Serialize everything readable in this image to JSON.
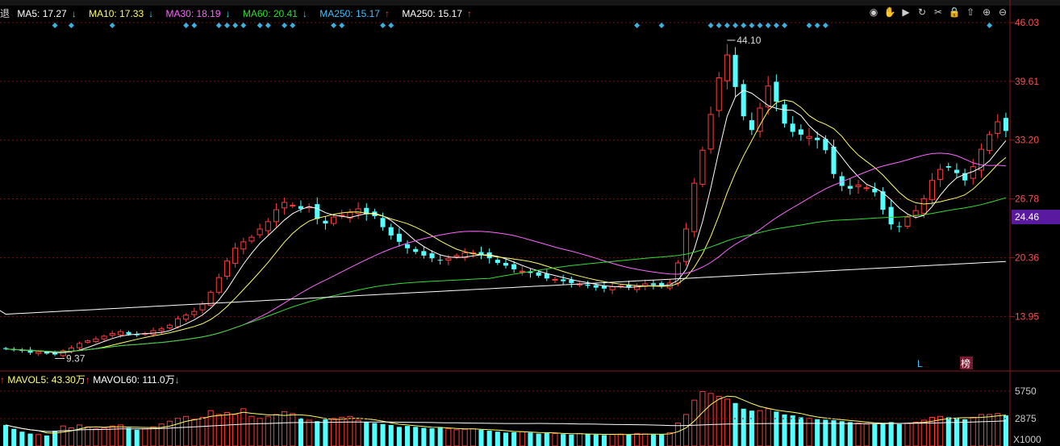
{
  "legend": {
    "ma5": "MA5: 17.27",
    "ma5_dir": "↓",
    "ma10": "MA10: 17.33",
    "ma10_dir": "↓",
    "ma30": "MA30: 18.19",
    "ma30_dir": "↓",
    "ma60": "MA60: 20.41",
    "ma60_dir": "↓",
    "ma250a": "MA250: 15.17",
    "ma250a_dir": "↑",
    "ma250b": "MA250: 15.17",
    "ma250b_dir": "↑"
  },
  "vol_legend": {
    "mavol5": "MAVOL5: 43.30万",
    "mavol5_dir": "↑",
    "mavol60": "MAVOL60: 111.0万",
    "mavol60_dir": "↓"
  },
  "colors": {
    "up": "#ff3b3b",
    "down": "#54ffff",
    "ma5": "#ffffff",
    "ma10": "#ffff66",
    "ma30": "#ff66ff",
    "ma60": "#33dd33",
    "ma250": "#ffffff",
    "grid": "#7a1010",
    "marker": "#39b0e0"
  },
  "tools": [
    "eye-icon",
    "hand-icon",
    "play-icon",
    "refresh-icon",
    "scissors-icon",
    "lock-icon",
    "upload-icon",
    "zoom-in-icon",
    "zoom-out-icon"
  ],
  "current_price": "24.46",
  "chart_data": [
    {
      "type": "candlestick",
      "title": "",
      "y_ticks": [
        "46.03",
        "39.61",
        "33.20",
        "26.78",
        "20.36",
        "13.95"
      ],
      "ylim": [
        8.0,
        46.03
      ],
      "grid": true,
      "annotations": [
        {
          "text": "44.10",
          "kind": "high"
        },
        {
          "text": "9.37",
          "kind": "low"
        }
      ],
      "badges": [
        "L",
        "榜"
      ],
      "series": [
        {
          "name": "MA5"
        },
        {
          "name": "MA10"
        },
        {
          "name": "MA30"
        },
        {
          "name": "MA60"
        },
        {
          "name": "MA250"
        }
      ],
      "close": [
        10.4,
        10.3,
        10.2,
        10.0,
        10.1,
        9.9,
        9.8,
        10.2,
        10.5,
        11.0,
        11.3,
        11.5,
        11.8,
        12.1,
        12.3,
        12.0,
        11.9,
        12.1,
        12.4,
        12.6,
        13.0,
        13.7,
        14.1,
        14.5,
        15.3,
        16.6,
        18.2,
        20.0,
        21.4,
        22.1,
        22.6,
        23.5,
        24.3,
        25.6,
        26.4,
        26.1,
        25.7,
        25.9,
        24.6,
        24.1,
        24.8,
        25.0,
        25.3,
        25.7,
        25.1,
        24.9,
        23.7,
        22.8,
        22.1,
        21.4,
        21.0,
        20.6,
        20.3,
        20.1,
        20.3,
        20.6,
        20.9,
        20.9,
        20.7,
        20.3,
        19.8,
        19.5,
        19.1,
        18.9,
        18.7,
        18.4,
        18.1,
        18.0,
        17.8,
        17.6,
        17.5,
        17.3,
        17.1,
        17.0,
        17.2,
        17.3,
        17.1,
        17.3,
        17.5,
        17.4,
        17.2,
        17.6,
        19.8,
        23.5,
        28.5,
        32.1,
        36.0,
        40.0,
        42.5,
        39.0,
        35.8,
        34.3,
        36.7,
        39.1,
        37.4,
        35.0,
        34.1,
        33.8,
        33.6,
        33.2,
        32.1,
        29.5,
        28.2,
        27.9,
        28.3,
        28.0,
        27.5,
        25.6,
        24.0,
        23.8,
        24.8,
        25.5,
        26.8,
        28.8,
        30.0,
        30.2,
        29.6,
        28.8,
        30.3,
        32.2,
        33.8,
        35.2,
        34.2
      ],
      "volume": [
        2200,
        1800,
        1500,
        1300,
        1200,
        1100,
        1600,
        2100,
        1900,
        2200,
        2000,
        1800,
        1900,
        2100,
        2200,
        1900,
        1700,
        1800,
        2000,
        2300,
        2600,
        2900,
        3100,
        2800,
        3000,
        3700,
        3300,
        3500,
        3300,
        3900,
        3100,
        2900,
        3100,
        3300,
        3600,
        3400,
        2900,
        2700,
        2600,
        2800,
        2900,
        3000,
        3100,
        2700,
        2500,
        2400,
        2300,
        2200,
        2000,
        2100,
        2000,
        1900,
        1850,
        1900,
        1800,
        1700,
        1750,
        1800,
        1700,
        1600,
        1500,
        1400,
        1450,
        1500,
        1400,
        1300,
        1350,
        1300,
        1250,
        1200,
        1300,
        1250,
        1200,
        1150,
        1200,
        1250,
        1200,
        1300,
        1250,
        1200,
        1200,
        1400,
        2400,
        3300,
        4800,
        5700,
        5500,
        5200,
        4900,
        4500,
        3900,
        3700,
        3700,
        3900,
        3600,
        3300,
        3200,
        3000,
        2900,
        2800,
        2750,
        2700,
        2600,
        2500,
        2400,
        2300,
        2300,
        2400,
        2500,
        2300,
        2400,
        2500,
        2700,
        3000,
        3100,
        3000,
        2900,
        2800,
        3000,
        3300,
        3300,
        3400,
        3200
      ],
      "volume_ticks": [
        "5750",
        "2875",
        "X1000"
      ]
    }
  ]
}
